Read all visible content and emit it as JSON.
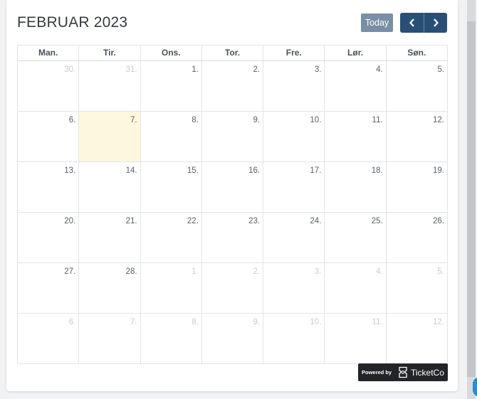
{
  "calendar": {
    "title": "FEBRUAR 2023",
    "today_label": "Today",
    "weekdays": [
      "Man.",
      "Tir.",
      "Ons.",
      "Tor.",
      "Fre.",
      "Lør.",
      "Søn."
    ],
    "weeks": [
      [
        {
          "n": "30.",
          "other": true
        },
        {
          "n": "31.",
          "other": true
        },
        {
          "n": "1."
        },
        {
          "n": "2."
        },
        {
          "n": "3."
        },
        {
          "n": "4."
        },
        {
          "n": "5."
        }
      ],
      [
        {
          "n": "6."
        },
        {
          "n": "7.",
          "today": true
        },
        {
          "n": "8."
        },
        {
          "n": "9."
        },
        {
          "n": "10."
        },
        {
          "n": "11."
        },
        {
          "n": "12."
        }
      ],
      [
        {
          "n": "13."
        },
        {
          "n": "14."
        },
        {
          "n": "15."
        },
        {
          "n": "16."
        },
        {
          "n": "17."
        },
        {
          "n": "18."
        },
        {
          "n": "19."
        }
      ],
      [
        {
          "n": "20."
        },
        {
          "n": "21."
        },
        {
          "n": "22."
        },
        {
          "n": "23."
        },
        {
          "n": "24."
        },
        {
          "n": "25."
        },
        {
          "n": "26."
        }
      ],
      [
        {
          "n": "27."
        },
        {
          "n": "28."
        },
        {
          "n": "1.",
          "other": true
        },
        {
          "n": "2.",
          "other": true
        },
        {
          "n": "3.",
          "other": true
        },
        {
          "n": "4.",
          "other": true
        },
        {
          "n": "5.",
          "other": true
        }
      ],
      [
        {
          "n": "6.",
          "other": true
        },
        {
          "n": "7.",
          "other": true
        },
        {
          "n": "8.",
          "other": true
        },
        {
          "n": "9.",
          "other": true
        },
        {
          "n": "10.",
          "other": true
        },
        {
          "n": "11.",
          "other": true
        },
        {
          "n": "12.",
          "other": true
        }
      ]
    ]
  },
  "footer": {
    "powered_label": "Powered by",
    "brand": "TicketCo"
  },
  "icons": {
    "prev": "chevron-left-icon",
    "next": "chevron-right-icon",
    "brand": "ticketco-logo-icon"
  },
  "colors": {
    "nav_button": "#294f76",
    "today_button": "#7a8ea6",
    "today_cell": "#fdf8dd",
    "badge_bg": "#222427"
  }
}
